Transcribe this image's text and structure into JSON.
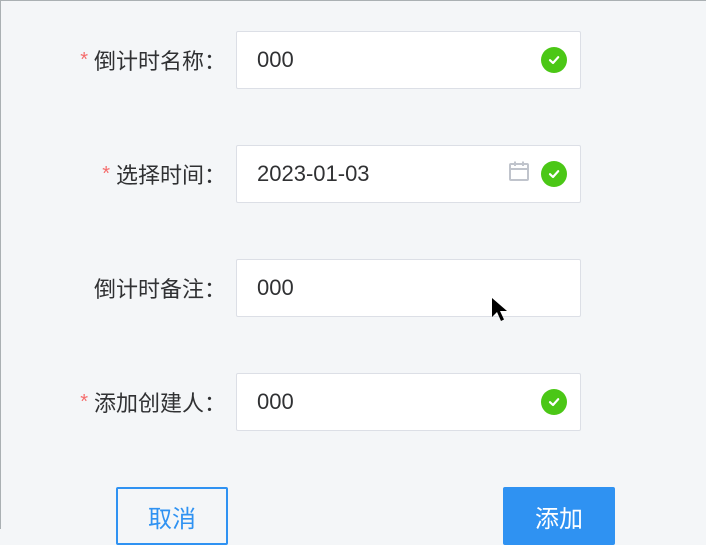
{
  "form": {
    "name": {
      "label": "倒计时名称：",
      "required": true,
      "value": "000",
      "validated": true
    },
    "time": {
      "label": "选择时间：",
      "required": true,
      "value": "2023-01-03",
      "validated": true
    },
    "remark": {
      "label": "倒计时备注：",
      "required": false,
      "value": "000",
      "validated": false
    },
    "creator": {
      "label": "添加创建人：",
      "required": true,
      "value": "000",
      "validated": true
    }
  },
  "footer": {
    "cancel_label": "取消",
    "submit_label": "添加"
  }
}
